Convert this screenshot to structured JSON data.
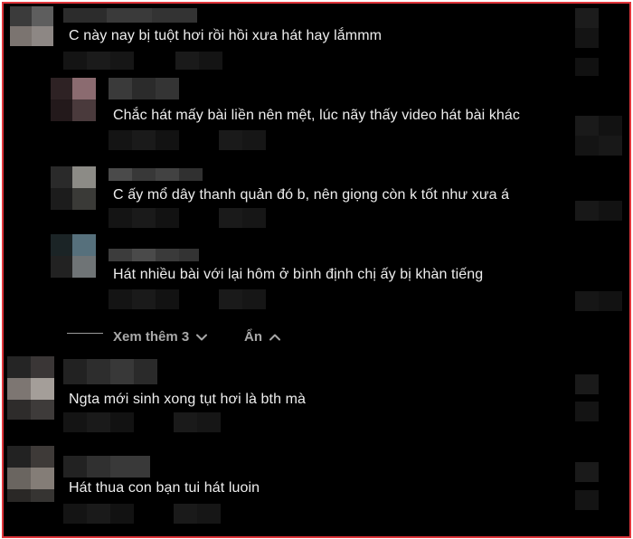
{
  "colors": {
    "frame_border": "#e0353b",
    "background": "#000000",
    "text": "#eeeeee",
    "muted": "#a8a8a8"
  },
  "comments": [
    {
      "text": "C này nay bị tuột hơi rồi hồi xưa hát hay lắmmm",
      "reply": false
    },
    {
      "text": "Chắc hát mấy bài liền nên mệt, lúc nãy thấy video hát bài khác",
      "reply": true
    },
    {
      "text": "C ấy mổ dây thanh quản đó b, nên giọng còn k tốt như xưa á",
      "reply": true
    },
    {
      "text": "Hát nhiều bài với lại hôm ở bình định chị ấy bị khàn tiếng",
      "reply": true
    },
    {
      "text": "Ngta mới sinh xong tụt hơi là bth mà",
      "reply": false
    },
    {
      "text": "Hát thua con bạn tui hát luoin",
      "reply": false
    }
  ],
  "replies_controls": {
    "view_more_label": "Xem thêm 3",
    "view_more_icon": "chevron-down-icon",
    "hide_label": "Ẩn",
    "hide_icon": "chevron-up-icon"
  }
}
